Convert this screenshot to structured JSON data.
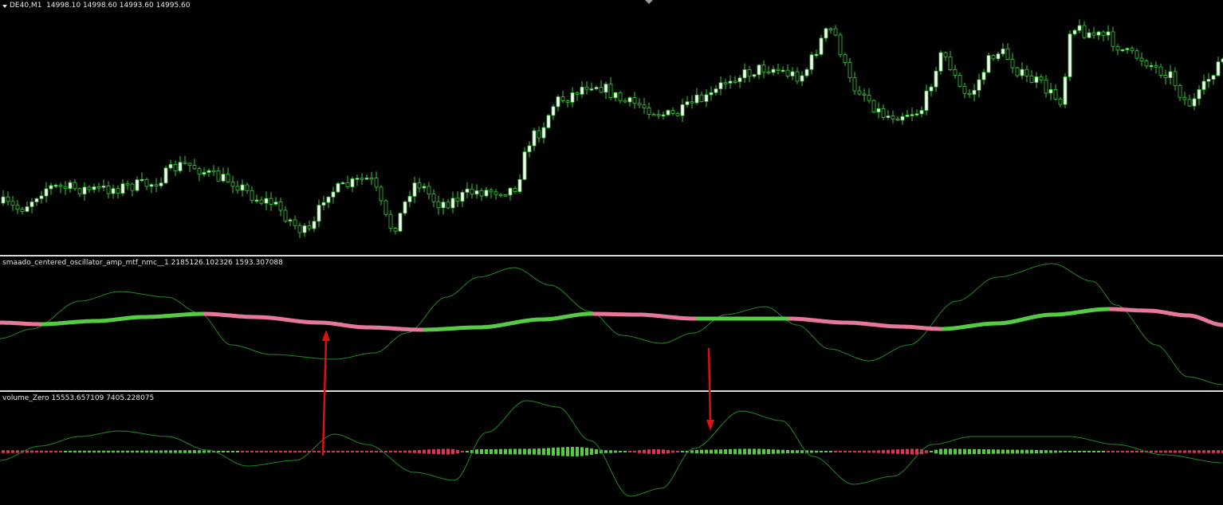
{
  "price_pane": {
    "symbol": "DE40,M1",
    "ohlc": "14998.10 14998.60 14993.60 14995.60",
    "colors": {
      "up": "#ffffff",
      "down": "#000000",
      "outline": "#33cc33",
      "wick": "#33cc33",
      "background": "#000000"
    }
  },
  "oscillator_pane": {
    "name": "smaado_centered_oscillator_amp_mtf_nmc__1",
    "values": "2185126.102326 1593.307088",
    "colors": {
      "rising": "#55cc44",
      "falling": "#e8789a",
      "thin_line": "#1f8a1f"
    }
  },
  "volume_pane": {
    "name": "volume_Zero",
    "values": "15553.657109 7405.228075",
    "colors": {
      "positive": "#55cc44",
      "negative": "#dd3355",
      "thin_line": "#1f8a1f"
    }
  },
  "annotations": {
    "arrow_color": "#dd1111",
    "arrows": [
      {
        "direction": "up-pointing",
        "icon": "up-arrow-icon"
      },
      {
        "direction": "down-pointing",
        "icon": "down-arrow-icon"
      }
    ]
  }
}
